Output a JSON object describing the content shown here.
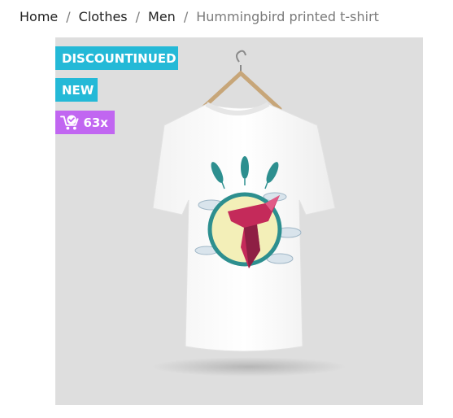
{
  "breadcrumb": {
    "items": [
      "Home",
      "Clothes",
      "Men"
    ],
    "current": "Hummingbird printed t-shirt",
    "separator": "/"
  },
  "product": {
    "flags": {
      "discontinued": "DISCOUNTINUED",
      "new": "NEW",
      "sold_count": "63x"
    },
    "image_icon": "tshirt-hummingbird-image",
    "colors": {
      "flag_blue": "#24b9d7",
      "flag_purple": "#c166f1",
      "image_background": "#dedede"
    }
  }
}
